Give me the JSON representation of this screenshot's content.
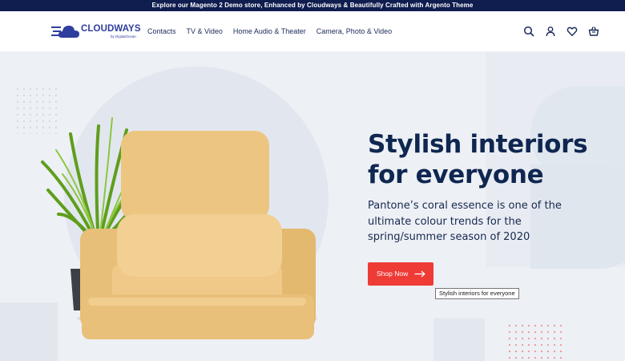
{
  "announcement": "Explore our Magento 2 Demo store, Enhanced by Cloudways & Beautifully Crafted with Argento Theme",
  "logo": {
    "brand": "CLOUDWAYS",
    "sub": "by DigitalOcean"
  },
  "nav": {
    "items": [
      {
        "label": "Contacts"
      },
      {
        "label": "TV & Video"
      },
      {
        "label": "Home Audio & Theater"
      },
      {
        "label": "Camera, Photo & Video"
      }
    ]
  },
  "header_icons": [
    "search-icon",
    "user-icon",
    "heart-icon",
    "basket-icon"
  ],
  "hero": {
    "title_line1": "Stylish interiors",
    "title_line2": "for everyone",
    "description": "Pantone’s coral essence is one of the ultimate colour trends for the spring/summer season of 2020",
    "cta_label": "Shop Now",
    "tooltip": "Stylish interiors for everyone"
  },
  "colors": {
    "topbar": "#0f1d4f",
    "brand_blue": "#2f3d9c",
    "cta_red": "#ef3b36",
    "hero_bg": "#edf0f5",
    "heading": "#0f2750"
  }
}
